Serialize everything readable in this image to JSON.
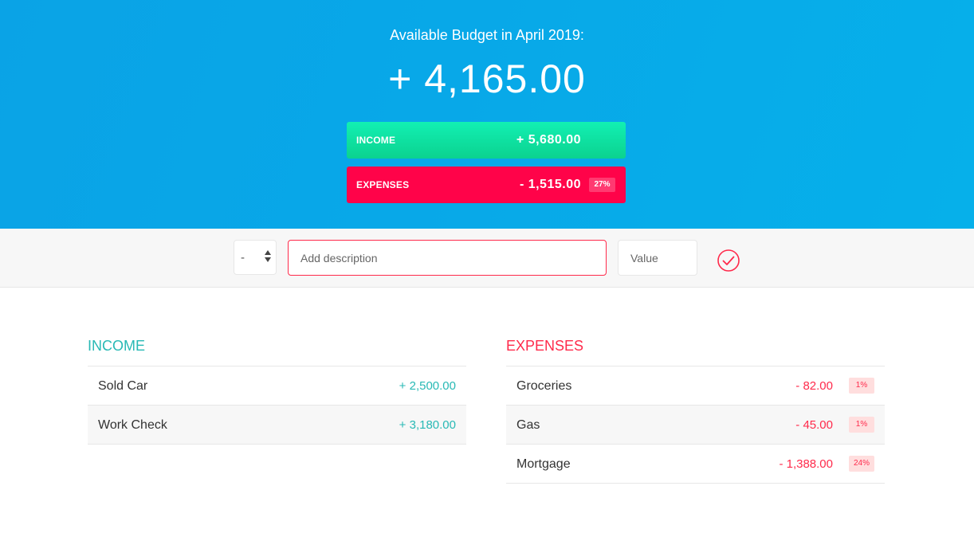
{
  "header": {
    "budget_title": "Available Budget in April 2019:",
    "budget_value": "+ 4,165.00",
    "income_label": "INCOME",
    "income_value": "+ 5,680.00",
    "expenses_label": "EXPENSES",
    "expenses_value": "- 1,515.00",
    "expenses_percentage": "27%"
  },
  "add_form": {
    "type_selected": "-",
    "description_placeholder": "Add description",
    "value_placeholder": "Value"
  },
  "income": {
    "title": "INCOME",
    "items": [
      {
        "description": "Sold Car",
        "value": "+ 2,500.00"
      },
      {
        "description": "Work Check",
        "value": "+ 3,180.00"
      }
    ]
  },
  "expenses": {
    "title": "EXPENSES",
    "items": [
      {
        "description": "Groceries",
        "value": "- 82.00",
        "percentage": "1%"
      },
      {
        "description": "Gas",
        "value": "- 45.00",
        "percentage": "1%"
      },
      {
        "description": "Mortgage",
        "value": "- 1,388.00",
        "percentage": "24%"
      }
    ]
  },
  "colors": {
    "header_bg": "#08a8e8",
    "income_accent": "#28b9b5",
    "expenses_accent": "#ff2a4b",
    "expenses_box": "#ff0349",
    "income_box": "#0fe0a1"
  },
  "icons": {
    "add": "check-circle-icon",
    "select": "up-down-arrows-icon"
  }
}
